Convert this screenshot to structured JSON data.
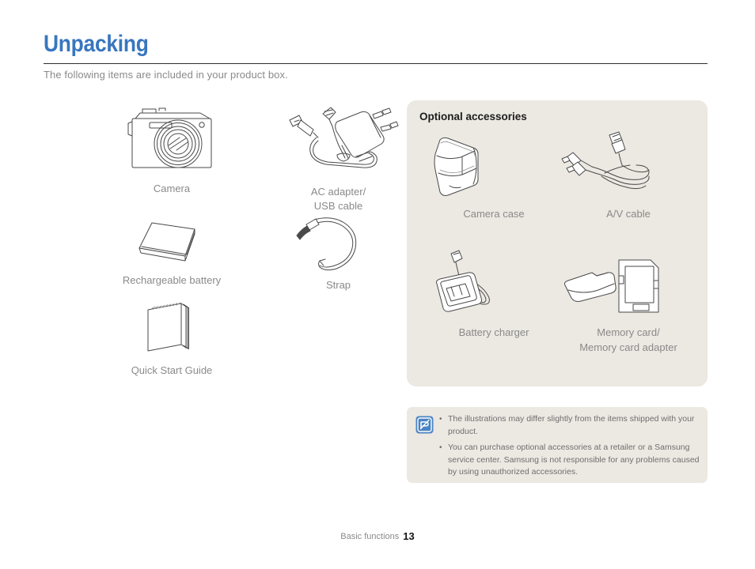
{
  "header": {
    "title": "Unpacking",
    "subtitle": "The following items are included in your product box."
  },
  "included_items": [
    {
      "id": "camera",
      "label": "Camera",
      "icon": "camera-illustration"
    },
    {
      "id": "adapter",
      "label": "AC adapter/\nUSB cable",
      "icon": "ac-adapter-usb-cable-illustration"
    },
    {
      "id": "battery",
      "label": "Rechargeable battery",
      "icon": "battery-illustration"
    },
    {
      "id": "strap",
      "label": "Strap",
      "icon": "strap-illustration"
    },
    {
      "id": "guide",
      "label": "Quick Start Guide",
      "icon": "quick-start-guide-illustration"
    }
  ],
  "optional_accessories": {
    "title": "Optional accessories",
    "items": [
      {
        "id": "case",
        "label": "Camera case",
        "icon": "camera-case-illustration"
      },
      {
        "id": "av",
        "label": "A/V cable",
        "icon": "av-cable-illustration"
      },
      {
        "id": "charger",
        "label": "Battery charger",
        "icon": "battery-charger-illustration"
      },
      {
        "id": "memory",
        "label": "Memory card/\nMemory card adapter",
        "icon": "memory-card-illustration"
      }
    ]
  },
  "note": {
    "icon": "note-pen-icon",
    "bullet": "•",
    "items": [
      "The illustrations may differ slightly from the items shipped with your product.",
      "You can purchase optional accessories at a retailer or a Samsung service center. Samsung is not responsible for any problems caused by using unauthorized accessories."
    ]
  },
  "footer": {
    "section": "Basic functions",
    "page_number": "13"
  },
  "colors": {
    "title_blue": "#3876bf",
    "panel_bg": "#ece8e2",
    "caption_gray": "#8a8a8a",
    "rule": "#2e2e2e"
  }
}
